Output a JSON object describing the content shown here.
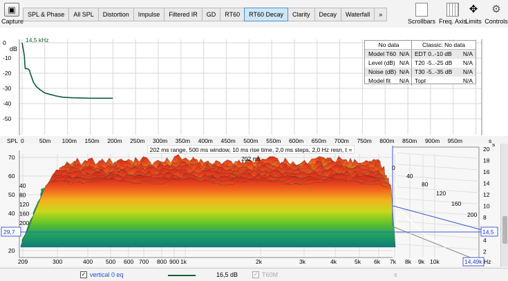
{
  "capture": {
    "label": "Capture"
  },
  "tabs": [
    {
      "label": "SPL & Phase",
      "active": false
    },
    {
      "label": "All SPL",
      "active": false
    },
    {
      "label": "Distortion",
      "active": false
    },
    {
      "label": "Impulse",
      "active": false
    },
    {
      "label": "Filtered IR",
      "active": false
    },
    {
      "label": "GD",
      "active": false
    },
    {
      "label": "RT60",
      "active": false
    },
    {
      "label": "RT60 Decay",
      "active": true
    },
    {
      "label": "Clarity",
      "active": false
    },
    {
      "label": "Decay",
      "active": false
    },
    {
      "label": "Waterfall",
      "active": false
    },
    {
      "label": "»",
      "active": false
    }
  ],
  "right_tools": {
    "scrollbars": "Scrollbars",
    "freq_axis": "Freq. Axis",
    "limits": "Limits",
    "controls": "Controls"
  },
  "top_plot": {
    "y_unit": "dB",
    "series_label": "14,5 kHz",
    "x_unit": "s",
    "y_ticks": [
      "0",
      "-10",
      "-20",
      "-30",
      "-40",
      "-50"
    ],
    "x_ticks": [
      "SPL",
      "0",
      "50m",
      "100m",
      "150m",
      "200m",
      "250m",
      "300m",
      "350m",
      "400m",
      "450m",
      "500m",
      "550m",
      "600m",
      "650m",
      "700m",
      "750m",
      "800m",
      "850m",
      "900m",
      "950m"
    ],
    "line_color": "#0b5e33"
  },
  "stats_table": {
    "header_left": "No data",
    "header_right": "Classic: No data",
    "rows": [
      {
        "l_label": "Model T60",
        "l_val": "N/A",
        "r_label": "EDT  0..-10 dB",
        "r_val": "N/A"
      },
      {
        "l_label": "Level (dB)",
        "l_val": "N/A",
        "r_label": "T20 -5..-25 dB",
        "r_val": "N/A"
      },
      {
        "l_label": "Noise (dB)",
        "l_val": "N/A",
        "r_label": "T30 -5..-35 dB",
        "r_val": "N/A"
      },
      {
        "l_label": "Model fit",
        "l_val": "N/A",
        "r_label": "Topt",
        "r_val": "N/A"
      }
    ]
  },
  "bottom_plot": {
    "caption": "202 ms range, 500 ms window, 10 ms rise time, 2,0 ms steps, 2,0 Hz resn, t = 202 ms",
    "y_ticks": [
      "70",
      "60",
      "50",
      "40",
      "30",
      "20"
    ],
    "right_ticks": [
      "20",
      "18",
      "16",
      "14",
      "12",
      "10",
      "8",
      "6",
      "4",
      "2"
    ],
    "depth_ticks": [
      "0",
      "40",
      "80",
      "120",
      "160",
      "200"
    ],
    "left_depth": [
      "40",
      "80",
      "120",
      "160",
      "200"
    ],
    "x_ticks": [
      "209",
      "300",
      "400",
      "500",
      "600",
      "700",
      "800",
      "900",
      "1k",
      "2k",
      "3k",
      "4k",
      "5k",
      "6k",
      "7k",
      "8k",
      "9k",
      "10k"
    ],
    "cursor_left": "29,7",
    "cursor_right": "14,5",
    "cursor_freq": "14,49k",
    "hz": "Hz",
    "s_label": "s"
  },
  "legend": {
    "item1": "vertical 0 eq",
    "value1": "16,5 dB",
    "item2": "T60M",
    "s": "s"
  }
}
